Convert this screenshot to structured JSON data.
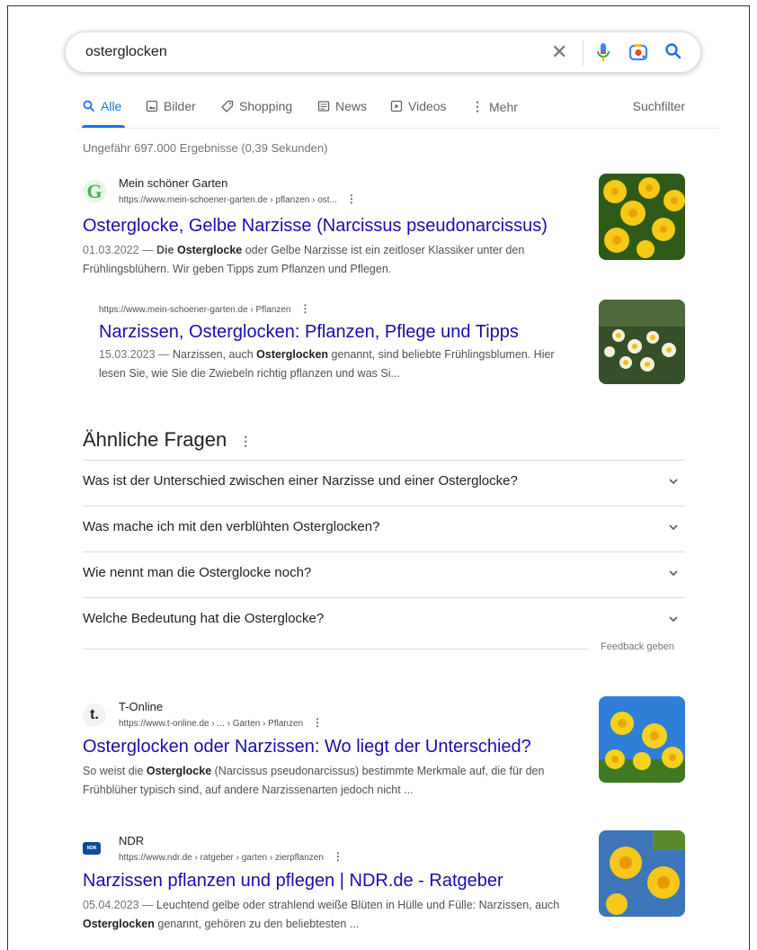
{
  "search": {
    "query": "osterglocken"
  },
  "tabs": [
    {
      "label": "Alle"
    },
    {
      "label": "Bilder"
    },
    {
      "label": "Shopping"
    },
    {
      "label": "News"
    },
    {
      "label": "Videos"
    },
    {
      "label": "Mehr"
    }
  ],
  "suchfilter": "Suchfilter",
  "stats": "Ungefähr 697.000 Ergebnisse (0,39 Sekunden)",
  "results": [
    {
      "site": "Mein schöner Garten",
      "favicon": "G",
      "url": "https://www.mein-schoener-garten.de › pflanzen › ost...",
      "title": "Osterglocke, Gelbe Narzisse (Narcissus pseudonarcissus)",
      "date": "01.03.2022 —",
      "snippet_1": "Die",
      "snippet_bold_1": "Osterglocke",
      "snippet_2": "oder Gelbe Narzisse ist ein zeitloser Klassiker unter den Frühlingsblühern. Wir geben Tipps zum Pflanzen und Pflegen."
    },
    {
      "url": "https://www.mein-schoener-garten.de › Pflanzen",
      "title": "Narzissen, Osterglocken: Pflanzen, Pflege und Tipps",
      "date": "15.03.2023 —",
      "snippet_1": "Narzissen, auch",
      "snippet_bold_1": "Osterglocken",
      "snippet_2": "genannt, sind beliebte Frühlingsblumen. Hier lesen Sie, wie Sie die Zwiebeln richtig pflanzen und was Si..."
    },
    {
      "site": "T-Online",
      "favicon": "t.",
      "url": "https://www.t-online.de › ... › Garten › Pflanzen",
      "title": "Osterglocken oder Narzissen: Wo liegt der Unterschied?",
      "snippet_1": "So weist die",
      "snippet_bold_1": "Osterglocke",
      "snippet_2": "(Narcissus pseudonarcissus) bestimmte Merkmale auf, die für den Frühblüher typisch sind, auf andere Narzissenarten jedoch nicht ..."
    },
    {
      "site": "NDR",
      "favicon": "NDR",
      "url": "https://www.ndr.de › ratgeber › garten › zierpflanzen",
      "title": "Narzissen pflanzen und pflegen | NDR.de - Ratgeber",
      "date": "05.04.2023 —",
      "snippet_1": "Leuchtend gelbe oder strahlend weiße Blüten in Hülle und Fülle: Narzissen, auch",
      "snippet_bold_1": "Osterglocken",
      "snippet_2": "genannt, gehören zu den beliebtesten ..."
    }
  ],
  "paa": {
    "title": "Ähnliche Fragen",
    "questions": [
      "Was ist der Unterschied zwischen einer Narzisse und einer Osterglocke?",
      "Was mache ich mit den verblühten Osterglocken?",
      "Wie nennt man die Osterglocke noch?",
      "Welche Bedeutung hat die Osterglocke?"
    ],
    "feedback": "Feedback geben"
  },
  "colors": {
    "link": "#1a0dab",
    "accent": "#1a73e8",
    "snippet": "#4d5156"
  }
}
